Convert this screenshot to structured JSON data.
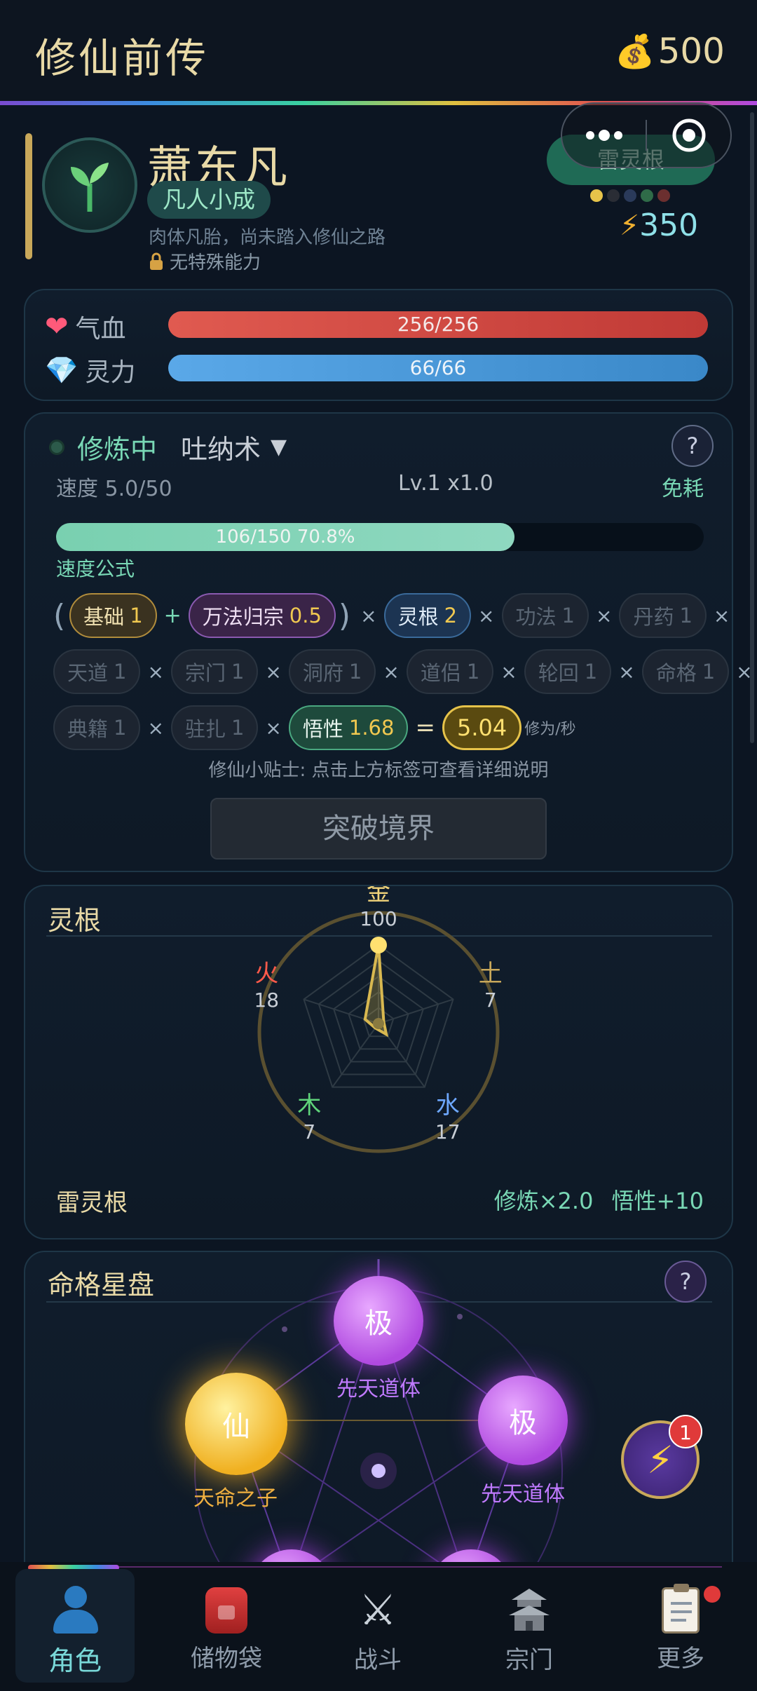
{
  "header": {
    "title": "修仙前传",
    "gold_icon": "money-bag-icon",
    "gold": "500"
  },
  "character": {
    "name": "萧东凡",
    "realm": "凡人小成",
    "desc": "肉体凡胎，尚未踏入修仙之路",
    "ability": "无特殊能力",
    "root_badge": "雷灵根",
    "energy": "350",
    "root_dots": [
      "#e6c34a",
      "#2a2d35",
      "#2a3a5a",
      "#2f6b48",
      "#6b2f2f"
    ]
  },
  "stats": {
    "hp_label": "气血",
    "hp_text": "256/256",
    "hp_fraction": 1.0,
    "mp_label": "灵力",
    "mp_text": "66/66",
    "mp_fraction": 1.0
  },
  "cultivation": {
    "status": "修炼中",
    "technique": "吐纳术",
    "help": "?",
    "speed": "速度 5.0/50",
    "level": "Lv.1 x1.0",
    "cost": "免耗",
    "progress_text": "106/150  70.8%",
    "progress_fraction": 0.708,
    "formula_title": "速度公式",
    "paren_open": "(",
    "paren_close": ")",
    "plus": "+",
    "times": "×",
    "equals": "=",
    "terms": [
      {
        "name": "基础",
        "val": "1"
      },
      {
        "name": "万法归宗",
        "val": "0.5"
      },
      {
        "name": "灵根",
        "val": "2"
      },
      {
        "name": "功法",
        "val": "1"
      },
      {
        "name": "丹药",
        "val": "1"
      },
      {
        "name": "天道",
        "val": "1"
      },
      {
        "name": "宗门",
        "val": "1"
      },
      {
        "name": "洞府",
        "val": "1"
      },
      {
        "name": "道侣",
        "val": "1"
      },
      {
        "name": "轮回",
        "val": "1"
      },
      {
        "name": "命格",
        "val": "1"
      },
      {
        "name": "典籍",
        "val": "1"
      },
      {
        "name": "驻扎",
        "val": "1"
      },
      {
        "name": "悟性",
        "val": "1.68"
      }
    ],
    "result": "5.04",
    "unit": "修为/秒",
    "tip": "修仙小贴士: 点击上方标签可查看详细说明",
    "breakthrough": "突破境界"
  },
  "spirit_root": {
    "title": "灵根",
    "elements": [
      {
        "name": "金",
        "value": "100",
        "color": "#f0d37a"
      },
      {
        "name": "土",
        "value": "7",
        "color": "#c9a85a"
      },
      {
        "name": "水",
        "value": "17",
        "color": "#6ea8ff"
      },
      {
        "name": "木",
        "value": "7",
        "color": "#5fd37a"
      },
      {
        "name": "火",
        "value": "18",
        "color": "#ff5a4a"
      }
    ],
    "root_name": "雷灵根",
    "bonus_cultivation": "修炼×2.0",
    "bonus_insight": "悟性+10"
  },
  "fate": {
    "title": "命格星盘",
    "help": "?",
    "stars": [
      {
        "glyph": "极",
        "label": "先天道体"
      },
      {
        "glyph": "仙",
        "label": "天命之子"
      },
      {
        "glyph": "极",
        "label": "先天道体"
      }
    ],
    "float_badge": "1"
  },
  "tabs": [
    {
      "label": "角色",
      "icon": "person-icon"
    },
    {
      "label": "储物袋",
      "icon": "backpack-icon"
    },
    {
      "label": "战斗",
      "icon": "crossed-swords-icon"
    },
    {
      "label": "宗门",
      "icon": "pagoda-icon"
    },
    {
      "label": "更多",
      "icon": "clipboard-icon"
    }
  ],
  "colors": {
    "accent_gold": "#e8d9a6",
    "teal": "#79d8b5",
    "hp": "#d44a44",
    "mp": "#4a9ed8"
  }
}
